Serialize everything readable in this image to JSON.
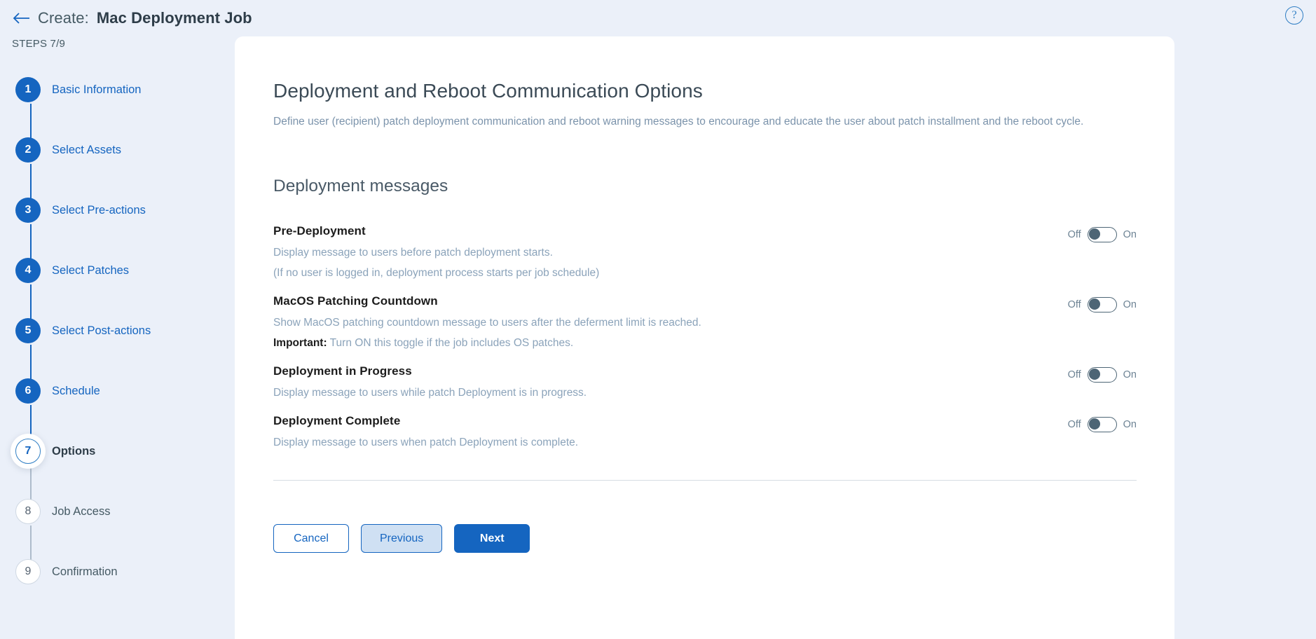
{
  "header": {
    "back_icon": "arrow-left-icon",
    "prefix": "Create:",
    "title": "Mac Deployment Job",
    "help_icon": "?"
  },
  "sidebar": {
    "steps_label": "STEPS 7/9",
    "items": [
      {
        "number": "1",
        "label": "Basic Information",
        "state": "done"
      },
      {
        "number": "2",
        "label": "Select Assets",
        "state": "done"
      },
      {
        "number": "3",
        "label": "Select Pre-actions",
        "state": "done"
      },
      {
        "number": "4",
        "label": "Select Patches",
        "state": "done"
      },
      {
        "number": "5",
        "label": "Select Post-actions",
        "state": "done"
      },
      {
        "number": "6",
        "label": "Schedule",
        "state": "done"
      },
      {
        "number": "7",
        "label": "Options",
        "state": "current"
      },
      {
        "number": "8",
        "label": "Job Access",
        "state": "pending"
      },
      {
        "number": "9",
        "label": "Confirmation",
        "state": "pending"
      }
    ]
  },
  "main": {
    "heading": "Deployment and Reboot Communication Options",
    "description": "Define user (recipient) patch deployment communication and reboot warning messages to encourage and educate the user about patch installment and the reboot cycle.",
    "section_heading": "Deployment messages",
    "toggle_off_label": "Off",
    "toggle_on_label": "On",
    "options": [
      {
        "title": "Pre-Deployment",
        "desc_line1": "Display message to users before patch deployment starts.",
        "desc_line2": "(If no user is logged in, deployment process starts per job schedule)",
        "state": "Off"
      },
      {
        "title": "MacOS Patching Countdown",
        "desc_line1": "Show MacOS patching countdown message to users after the deferment limit is reached.",
        "desc_line2_strong": "Important:",
        "desc_line2": " Turn ON this toggle if the job includes OS patches.",
        "state": "Off"
      },
      {
        "title": "Deployment in Progress",
        "desc_line1": "Display message to users while patch Deployment is in progress.",
        "desc_line2": "",
        "state": "Off"
      },
      {
        "title": "Deployment Complete",
        "desc_line1": "Display message to users when patch Deployment is complete.",
        "desc_line2": "",
        "state": "Off"
      }
    ]
  },
  "footer": {
    "cancel_label": "Cancel",
    "previous_label": "Previous",
    "next_label": "Next"
  },
  "colors": {
    "accent": "#1565c0",
    "page_bg": "#ebf0f9",
    "card_bg": "#ffffff",
    "muted_text": "#8ba3ba"
  }
}
